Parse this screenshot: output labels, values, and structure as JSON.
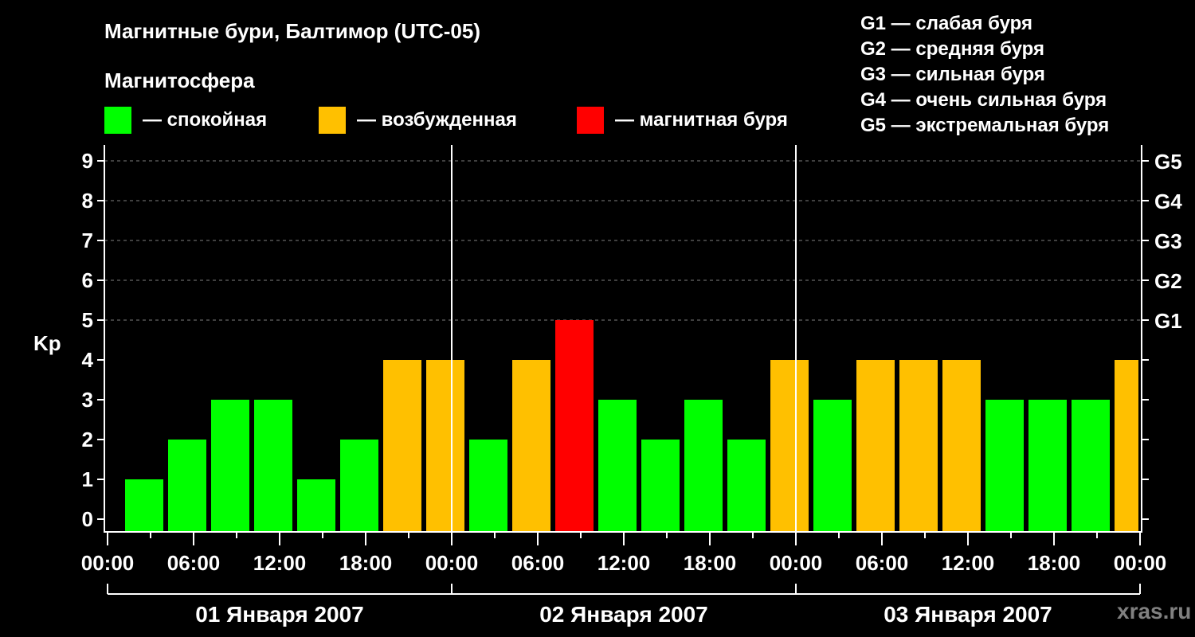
{
  "title": "Магнитные бури, Балтимор (UTC-05)",
  "legend": {
    "heading": "Магнитосфера",
    "items": [
      {
        "label": "— спокойная",
        "color": "#00ff00"
      },
      {
        "label": "— возбужденная",
        "color": "#ffc000"
      },
      {
        "label": "— магнитная буря",
        "color": "#ff0000"
      }
    ]
  },
  "g_scale": [
    "G1 — слабая буря",
    "G2 — средняя буря",
    "G3 — сильная буря",
    "G4 — очень сильная буря",
    "G5 — экстремальная буря"
  ],
  "watermark": "xras.ru",
  "chart_data": {
    "type": "bar",
    "ylabel": "Kp",
    "ylim": [
      0,
      9
    ],
    "yticks": [
      "0",
      "1",
      "2",
      "3",
      "4",
      "5",
      "6",
      "7",
      "8",
      "9"
    ],
    "right_ticks": [
      {
        "kp": 5,
        "label": "G1"
      },
      {
        "kp": 6,
        "label": "G2"
      },
      {
        "kp": 7,
        "label": "G3"
      },
      {
        "kp": 8,
        "label": "G4"
      },
      {
        "kp": 9,
        "label": "G5"
      }
    ],
    "grid_levels": [
      5,
      6,
      7,
      8,
      9
    ],
    "xticks": [
      "00:00",
      "06:00",
      "12:00",
      "18:00",
      "00:00",
      "06:00",
      "12:00",
      "18:00",
      "00:00",
      "06:00",
      "12:00",
      "18:00",
      "00:00"
    ],
    "days": [
      "01 Января 2007",
      "02 Января 2007",
      "03 Января 2007"
    ],
    "hours_per_bar": 3,
    "values": [
      1,
      2,
      3,
      3,
      1,
      2,
      4,
      4,
      2,
      4,
      5,
      3,
      2,
      3,
      2,
      4,
      3,
      4,
      4,
      4,
      3,
      3,
      3,
      4
    ],
    "colors": {
      "quiet": "#00ff00",
      "active": "#ffc000",
      "storm": "#ff0000"
    }
  }
}
